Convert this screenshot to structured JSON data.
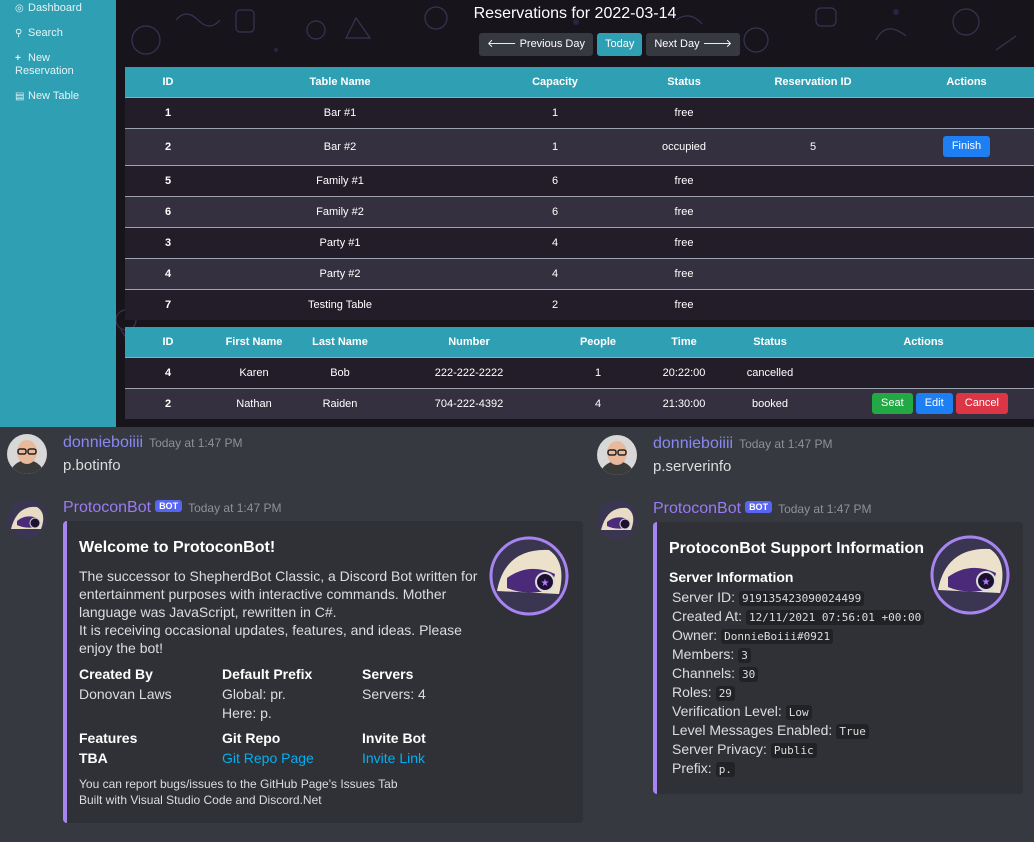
{
  "sidebar": {
    "items": [
      {
        "label": "Dashboard",
        "icon": "dashboard-icon"
      },
      {
        "label": "Search",
        "icon": "search-icon"
      },
      {
        "label": "New Reservation",
        "icon": "plus-icon"
      },
      {
        "label": "New Table",
        "icon": "table-icon"
      }
    ]
  },
  "reservations": {
    "title": "Reservations for 2022-03-14",
    "nav": {
      "previous": "Previous Day",
      "today": "Today",
      "next": "Next Day"
    }
  },
  "tables": {
    "headers": [
      "ID",
      "Table Name",
      "Capacity",
      "Status",
      "Reservation ID",
      "Actions"
    ],
    "rows": [
      {
        "id": "1",
        "name": "Bar #1",
        "capacity": "1",
        "status": "free",
        "reservation_id": "",
        "action": ""
      },
      {
        "id": "2",
        "name": "Bar #2",
        "capacity": "1",
        "status": "occupied",
        "reservation_id": "5",
        "action": "Finish"
      },
      {
        "id": "5",
        "name": "Family #1",
        "capacity": "6",
        "status": "free",
        "reservation_id": "",
        "action": ""
      },
      {
        "id": "6",
        "name": "Family #2",
        "capacity": "6",
        "status": "free",
        "reservation_id": "",
        "action": ""
      },
      {
        "id": "3",
        "name": "Party #1",
        "capacity": "4",
        "status": "free",
        "reservation_id": "",
        "action": ""
      },
      {
        "id": "4",
        "name": "Party #2",
        "capacity": "4",
        "status": "free",
        "reservation_id": "",
        "action": ""
      },
      {
        "id": "7",
        "name": "Testing Table",
        "capacity": "2",
        "status": "free",
        "reservation_id": "",
        "action": ""
      }
    ]
  },
  "reservation_list": {
    "headers": [
      "ID",
      "First Name",
      "Last Name",
      "Number",
      "People",
      "Time",
      "Status",
      "Actions"
    ],
    "rows": [
      {
        "id": "4",
        "first": "Karen",
        "last": "Bob",
        "number": "222-222-2222",
        "people": "1",
        "time": "20:22:00",
        "status": "cancelled"
      },
      {
        "id": "2",
        "first": "Nathan",
        "last": "Raiden",
        "number": "704-222-4392",
        "people": "4",
        "time": "21:30:00",
        "status": "booked"
      }
    ],
    "actions": {
      "seat": "Seat",
      "edit": "Edit",
      "cancel": "Cancel"
    }
  },
  "discord": {
    "left": {
      "user_name": "donnieboiiii",
      "user_time": "Today at 1:47 PM",
      "command": "p.botinfo",
      "bot_name": "ProtoconBot",
      "bot_badge": "BOT",
      "bot_time": "Today at 1:47 PM",
      "embed": {
        "title": "Welcome to ProtoconBot!",
        "description": "The successor to ShepherdBot Classic, a Discord Bot written for entertainment purposes with interactive commands. Mother language was JavaScript, rewritten in C#.\nIt is receiving occasional updates, features, and ideas. Please enjoy the bot!",
        "fields": {
          "created_by": {
            "name": "Created By",
            "value": "Donovan Laws"
          },
          "default_prefix": {
            "name": "Default Prefix",
            "value_global": "Global: pr.",
            "value_here": "Here: p."
          },
          "servers": {
            "name": "Servers",
            "value": "Servers: 4"
          },
          "features": {
            "name": "Features",
            "value": "TBA"
          },
          "git_repo": {
            "name": "Git Repo",
            "value": "Git Repo Page"
          },
          "invite_bot": {
            "name": "Invite Bot",
            "value": "Invite Link"
          }
        },
        "footer_line1": "You can report bugs/issues to the GitHub Page's Issues Tab",
        "footer_line2": "Built with Visual Studio Code and Discord.Net"
      }
    },
    "right": {
      "user_name": "donnieboiiii",
      "user_time": "Today at 1:47 PM",
      "command": "p.serverinfo",
      "bot_name": "ProtoconBot",
      "bot_badge": "BOT",
      "bot_time": "Today at 1:47 PM",
      "embed": {
        "title": "ProtoconBot Support Information",
        "section": "Server Information",
        "lines": [
          {
            "label": "Server ID:",
            "value": "919135423090024499"
          },
          {
            "label": "Created At:",
            "value": "12/11/2021 07:56:01 +00:00"
          },
          {
            "label": "Owner:",
            "value": "DonnieBoiii#0921"
          },
          {
            "label": "Members:",
            "value": "3"
          },
          {
            "label": "Channels:",
            "value": "30"
          },
          {
            "label": "Roles:",
            "value": "29"
          },
          {
            "label": "Verification Level:",
            "value": "Low"
          },
          {
            "label": "Level Messages Enabled:",
            "value": "True"
          },
          {
            "label": "Server Privacy:",
            "value": "Public"
          },
          {
            "label": "Prefix:",
            "value": "p."
          }
        ]
      }
    }
  },
  "colors": {
    "teal": "#2f9fb3",
    "discord_bg": "#36393f",
    "embed_bg": "#2f3136",
    "embed_accent": "#a785f0",
    "link": "#00aff4"
  }
}
